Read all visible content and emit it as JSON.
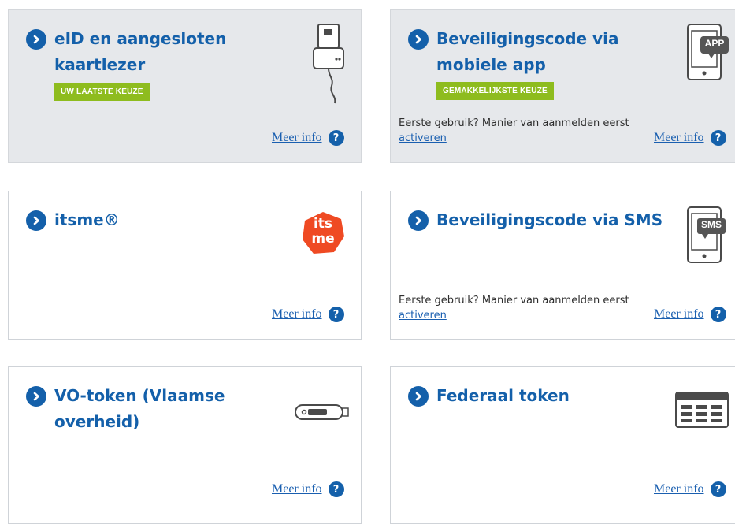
{
  "colors": {
    "accent": "#1460aa",
    "badge": "#8ebc1e",
    "link": "#1a5fb0",
    "itsme": "#ef4a23"
  },
  "help_glyph": "?",
  "cards": [
    {
      "title": "eID en aangesloten kaartlezer",
      "badge": "UW LAATSTE KEUZE",
      "meer": "Meer info",
      "icon": "card-reader-icon",
      "selected": true
    },
    {
      "title": "Beveiligingscode via mobiele app",
      "badge": "GEMAKKELIJKSTE KEUZE",
      "note_text": "Eerste gebruik? Manier van aanmelden eerst",
      "note_link": "activeren",
      "meer": "Meer info",
      "icon": "phone-app-icon",
      "icon_label": "APP"
    },
    {
      "title": "itsme®",
      "meer": "Meer info",
      "icon": "itsme-logo",
      "logo_text": [
        "its",
        "me"
      ]
    },
    {
      "title": "Beveiligingscode via SMS",
      "note_text": "Eerste gebruik? Manier van aanmelden eerst",
      "note_link": "activeren",
      "meer": "Meer info",
      "icon": "phone-sms-icon",
      "icon_label": "SMS"
    },
    {
      "title": "VO-token (Vlaamse overheid)",
      "meer": "Meer info",
      "icon": "usb-token-icon"
    },
    {
      "title": "Federaal token",
      "meer": "Meer info",
      "icon": "token-card-icon"
    }
  ]
}
